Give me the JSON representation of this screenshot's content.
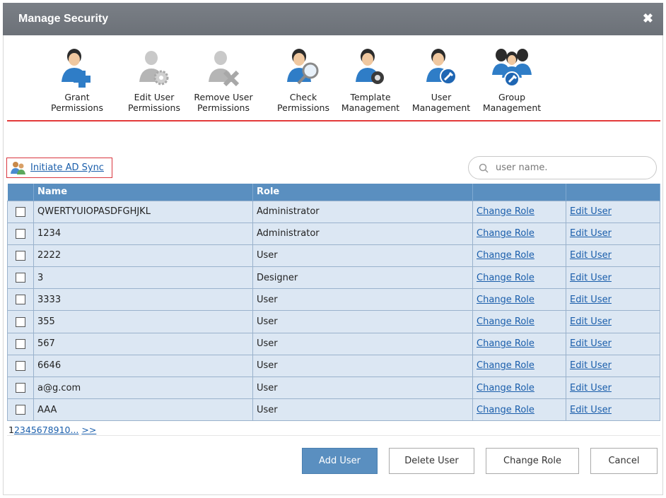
{
  "window": {
    "title": "Manage Security",
    "close_glyph": "✖"
  },
  "toolbar": [
    {
      "line1": "Grant",
      "line2": "Permissions",
      "icon": "user-plus-icon"
    },
    {
      "line1": "Edit User",
      "line2": "Permissions",
      "icon": "user-gear-icon"
    },
    {
      "line1": "Remove User",
      "line2": "Permissions",
      "icon": "user-remove-icon"
    },
    {
      "line1": "Check",
      "line2": "Permissions",
      "icon": "user-search-icon"
    },
    {
      "line1": "Template",
      "line2": "Management",
      "icon": "user-lock-icon"
    },
    {
      "line1": "User",
      "line2": "Management",
      "icon": "user-wrench-icon"
    },
    {
      "line1": "Group",
      "line2": "Management",
      "icon": "group-wrench-icon"
    }
  ],
  "ad_sync": {
    "label": "Initiate AD Sync",
    "icon": "users-sync-icon"
  },
  "search": {
    "placeholder": "user name."
  },
  "table": {
    "headers": [
      "",
      "Name",
      "Role",
      "",
      ""
    ],
    "rows": [
      {
        "name": "QWERTYUIOPASDFGHJKL",
        "role": "Administrator",
        "change": "Change Role",
        "edit": "Edit User"
      },
      {
        "name": "1234",
        "role": "Administrator",
        "change": "Change Role",
        "edit": "Edit User"
      },
      {
        "name": "2222",
        "role": "User",
        "change": "Change Role",
        "edit": "Edit User"
      },
      {
        "name": "3",
        "role": "Designer",
        "change": "Change Role",
        "edit": "Edit User"
      },
      {
        "name": "3333",
        "role": "User",
        "change": "Change Role",
        "edit": "Edit User"
      },
      {
        "name": "355",
        "role": "User",
        "change": "Change Role",
        "edit": "Edit User"
      },
      {
        "name": "567",
        "role": "User",
        "change": "Change Role",
        "edit": "Edit User"
      },
      {
        "name": "6646",
        "role": "User",
        "change": "Change Role",
        "edit": "Edit User"
      },
      {
        "name": "a@g.com",
        "role": "User",
        "change": "Change Role",
        "edit": "Edit User"
      },
      {
        "name": "AAA",
        "role": "User",
        "change": "Change Role",
        "edit": "Edit User"
      }
    ]
  },
  "pager": {
    "current": "1",
    "pages": [
      "2",
      "3",
      "4",
      "5",
      "6",
      "7",
      "8",
      "9",
      "10"
    ],
    "more": "...",
    "next": ">>"
  },
  "buttons": {
    "add_user": "Add User",
    "delete_user": "Delete User",
    "change_role": "Change Role",
    "cancel": "Cancel"
  },
  "colors": {
    "title_bar": "#6c7178",
    "header_blue": "#5a8fc0",
    "row_bg": "#dce7f3",
    "link_blue": "#1a5eab",
    "red_accent": "#e33a3a"
  }
}
